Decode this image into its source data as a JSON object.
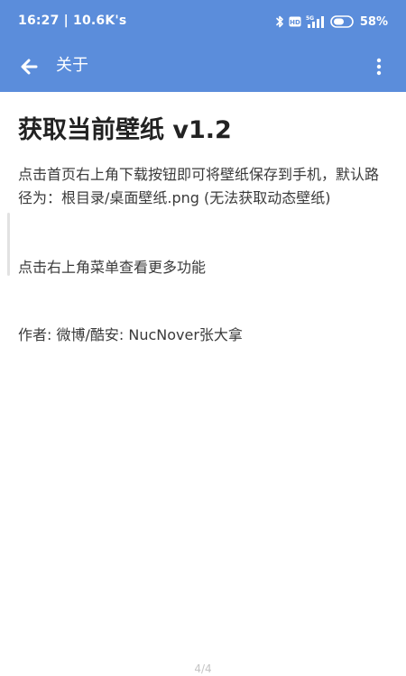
{
  "status_bar": {
    "time_speed": "16:27 | 10.6K's",
    "network": "5G",
    "battery": "58%"
  },
  "app_bar": {
    "title": "关于"
  },
  "content": {
    "heading": "获取当前壁纸 v1.2",
    "paragraph_1": "点击首页右上角下载按钮即可将壁纸保存到手机，默认路径为：根目录/桌面壁纸.png (无法获取动态壁纸)",
    "paragraph_2": "点击右上角菜单查看更多功能",
    "paragraph_3": "作者: 微博/酷安: NucNover张大拿"
  },
  "page_indicator": "4/4",
  "colors": {
    "header_bg": "#5b8ddb",
    "header_fg": "#ffffff",
    "body_text": "#3a3a3a",
    "heading_text": "#222222"
  },
  "icons": {
    "back": "arrow-left-icon",
    "menu": "more-vertical-icon",
    "bluetooth": "bluetooth-icon",
    "hd": "hd-icon",
    "signal": "signal-icon",
    "toggle": "toggle-icon"
  }
}
